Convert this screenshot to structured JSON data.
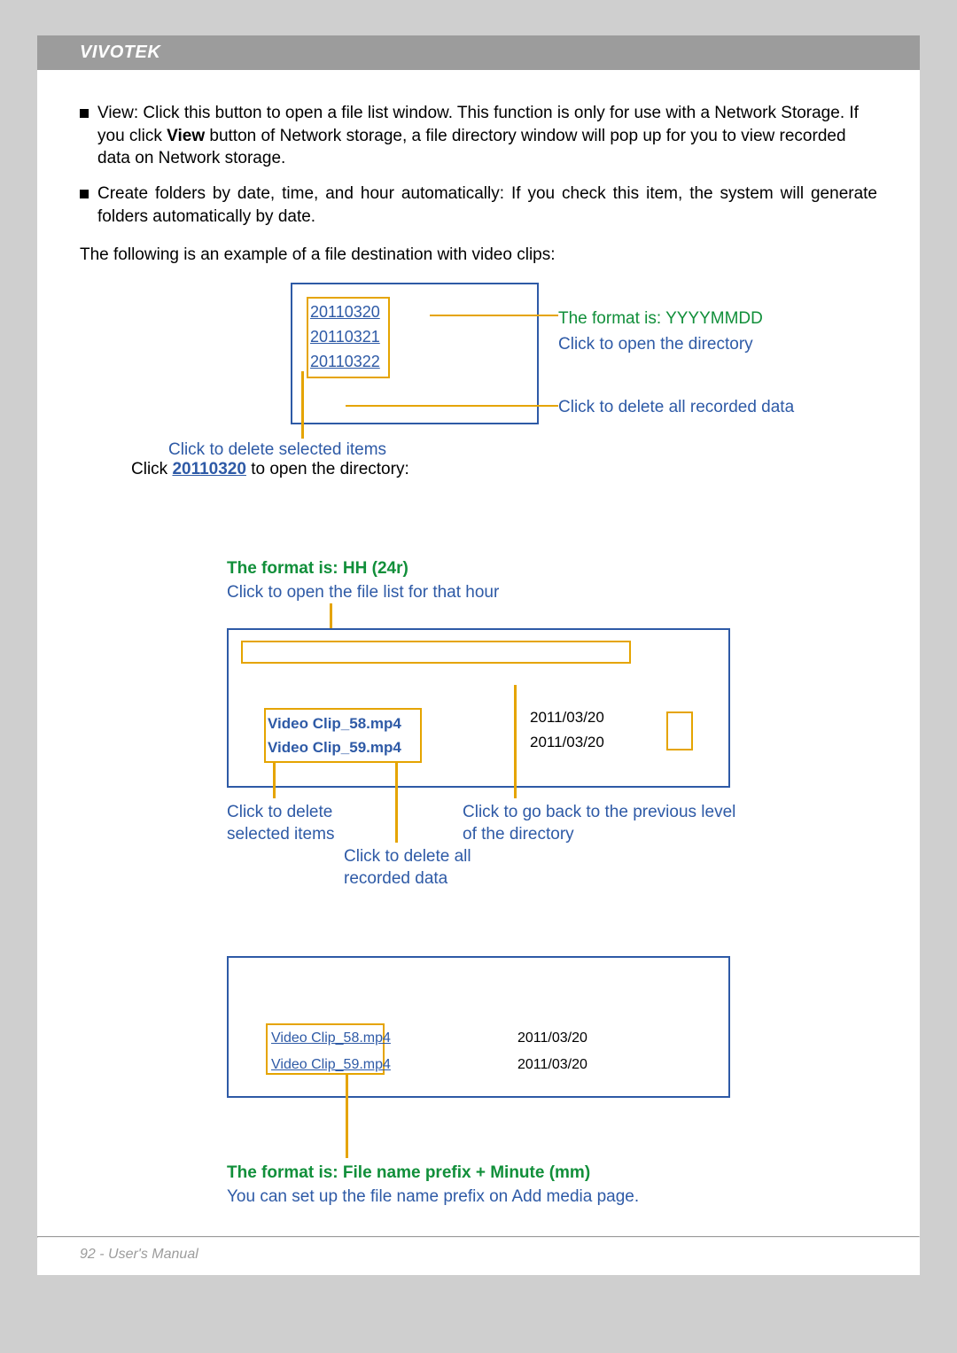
{
  "header": {
    "brand": "VIVOTEK"
  },
  "bullets": {
    "b1_pre": "View: Click this button to open a file list window. This function is only for use with a Network Storage. If you click ",
    "b1_bold": "View",
    "b1_post": " button of Network storage, a file directory window will pop up for you to view recorded data on Network storage.",
    "b2": "Create folders by date, time, and hour automatically: If you check this item, the system will generate folders automatically by date."
  },
  "intro": "The following is an example of a file destination with video clips:",
  "diagram1": {
    "dates": [
      "20110320",
      "20110321",
      "20110322"
    ],
    "callout_format": "The format is: YYYYMMDD",
    "callout_open": "Click to open the directory",
    "callout_delete_all": "Click to delete all recorded data",
    "callout_delete_sel": "Click to delete selected items",
    "click_pre": "Click ",
    "click_link": "20110320",
    "click_post": " to open the directory:"
  },
  "diagram2": {
    "hh_format": "The format is: HH (24r)",
    "hh_open": "Click to open the file list for that hour",
    "files": [
      "Video Clip_58.mp4",
      "Video Clip_59.mp4"
    ],
    "dates": [
      "2011/03/20",
      "2011/03/20"
    ],
    "cap_delete_sel": "Click to delete selected items",
    "cap_delete_all": "Click to delete all recorded data",
    "cap_back": "Click to go back to the previous level of the directory"
  },
  "diagram3": {
    "files": [
      "Video Clip_58.mp4",
      "Video Clip_59.mp4"
    ],
    "dates": [
      "2011/03/20",
      "2011/03/20"
    ],
    "caption_format": "The format is: File name prefix + Minute (mm)",
    "caption_setup": "You can set up the file name prefix on Add media page."
  },
  "footer": {
    "text": "92 - User's Manual"
  }
}
